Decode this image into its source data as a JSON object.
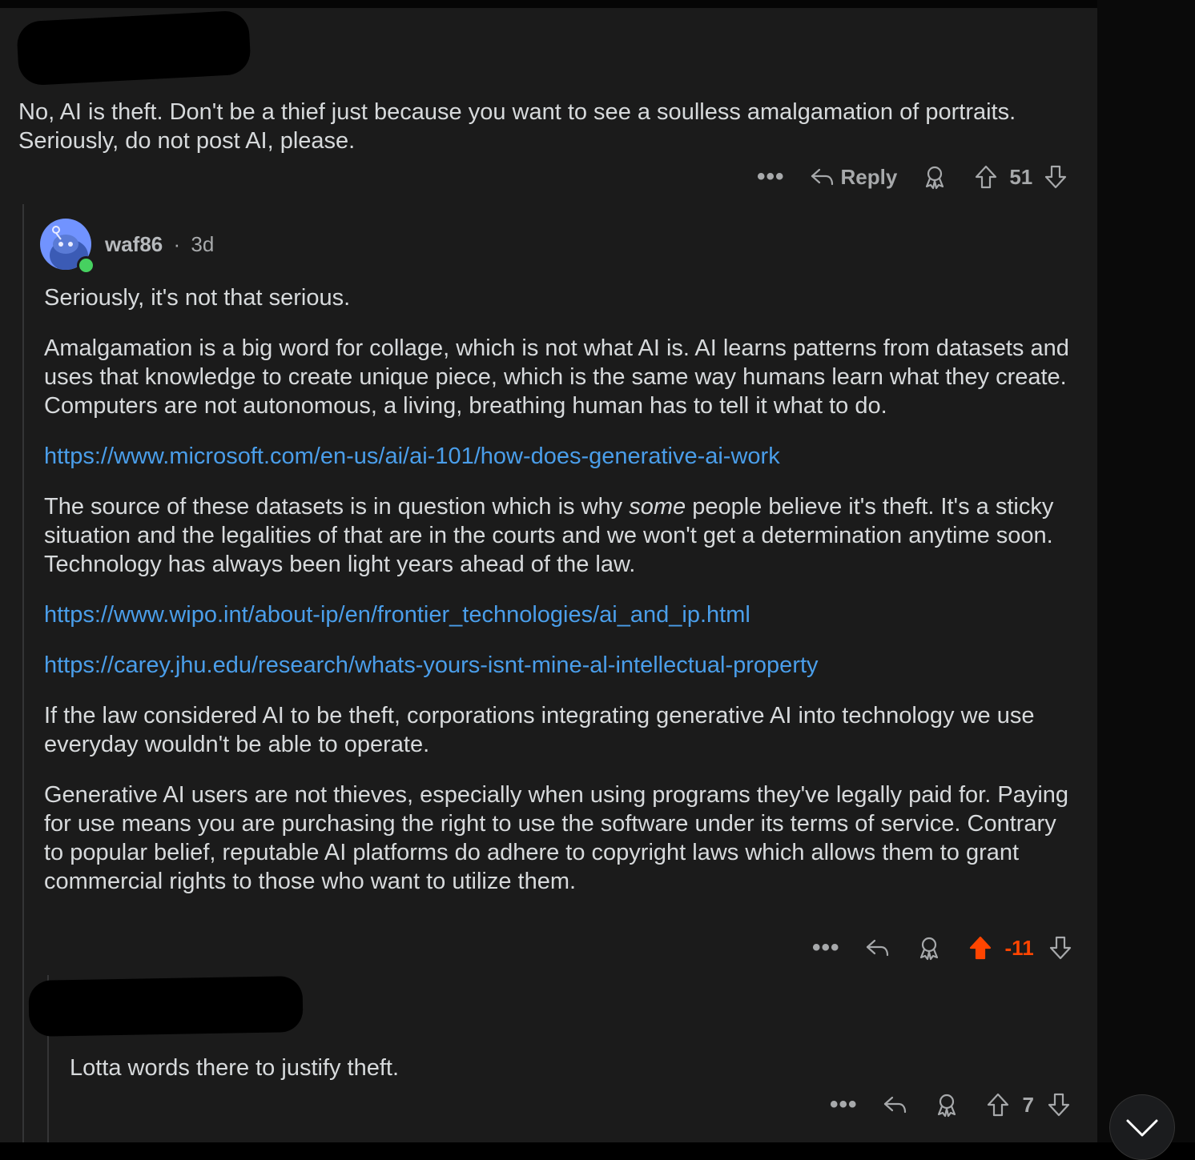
{
  "comment1": {
    "text": "No, AI is theft. Don't be a thief just because you want to see a soulless amalgamation of portraits. Seriously, do not post AI, please.",
    "more_label": "•••",
    "reply_label": "Reply",
    "score": "51"
  },
  "comment2": {
    "username": "waf86",
    "separator": "·",
    "age": "3d",
    "p1": "Seriously, it's not that serious.",
    "p2": "Amalgamation is a big word for collage, which is not what AI is. AI learns patterns from datasets and uses that knowledge to create unique piece, which is the same way humans learn what they create. Computers are not autonomous, a living, breathing human has to tell it what to do.",
    "link1": "https://www.microsoft.com/en-us/ai/ai-101/how-does-generative-ai-work",
    "p3_before": "The source of these datasets is in question which is why ",
    "p3_em": "some",
    "p3_after": " people believe it's theft. It's a sticky situation and the legalities of that are in the courts and we won't get a determination anytime soon. Technology has always been light years ahead of the law.",
    "link2": "https://www.wipo.int/about-ip/en/frontier_technologies/ai_and_ip.html",
    "link3": "https://carey.jhu.edu/research/whats-yours-isnt-mine-al-intellectual-property",
    "p4": "If the law considered AI to be theft, corporations integrating generative AI into technology we use everyday wouldn't be able to operate.",
    "p5": "Generative AI users are not thieves, especially when using programs they've legally paid for. Paying for use means you are purchasing the right to use the software under its terms of service. Contrary to popular belief, reputable AI platforms do adhere to copyright laws which allows them to grant commercial rights to those who want to utilize them.",
    "more_label": "•••",
    "score": "-11",
    "upvoted": true,
    "upvote_color": "#ff4500"
  },
  "comment3": {
    "text": "Lotta words there to justify theft.",
    "more_label": "•••",
    "score": "7"
  },
  "colors": {
    "background": "#1b1b1b",
    "link": "#4a9eea",
    "text": "#d7dadc",
    "muted": "#a7a9ab",
    "upvote_active": "#ff4500",
    "online": "#46d160",
    "avatar": "#7193ff"
  }
}
